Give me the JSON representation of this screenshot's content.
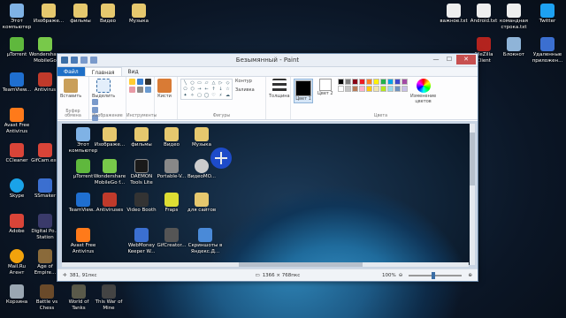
{
  "desktop": {
    "left_icons": [
      {
        "label": "Этот компьютер",
        "color": "#7fb2e5"
      },
      {
        "label": "Изображе...",
        "color": "#e6c86e"
      },
      {
        "label": "фильмы",
        "color": "#e6c86e"
      },
      {
        "label": "Видео",
        "color": "#e6c86e"
      },
      {
        "label": "Музыка",
        "color": "#e6c86e"
      },
      {
        "label": "µTorrent",
        "color": "#5fb83d"
      },
      {
        "label": "Wondershare MobileGo",
        "color": "#78c94a"
      },
      {
        "label": "TeamView...",
        "color": "#1f6fd0"
      },
      {
        "label": "Antivirus",
        "color": "#c03a2b"
      },
      {
        "label": "Avast Free Antivirus",
        "color": "#ff7a1a"
      },
      {
        "label": "CCleaner",
        "color": "#d94438"
      },
      {
        "label": "GifCam.exe",
        "color": "#d94438"
      },
      {
        "label": "Skype",
        "color": "#1aa3e8"
      },
      {
        "label": "SSmaker",
        "color": "#3b6fd0"
      },
      {
        "label": "Adobe",
        "color": "#d94438"
      },
      {
        "label": "Digital Po... Station",
        "color": "#3a3a6a"
      },
      {
        "label": "Mail.Ru Агент",
        "color": "#f2a20c"
      },
      {
        "label": "Age of Empire...",
        "color": "#8a6a3a"
      },
      {
        "label": "Корзина",
        "color": "#9aa6b2"
      },
      {
        "label": "Battle vs Chess",
        "color": "#6a4a2a"
      },
      {
        "label": "World of Tanks",
        "color": "#5a5a4a"
      },
      {
        "label": "This War of Mine",
        "color": "#444444"
      }
    ],
    "right_icons": [
      {
        "label": "важное.txt",
        "color": "#eeeeee"
      },
      {
        "label": "Android.txt",
        "color": "#eeeeee"
      },
      {
        "label": "командная строка.txt",
        "color": "#eeeeee"
      },
      {
        "label": "Twitter",
        "color": "#1da1f2"
      },
      {
        "label": "FileZilla Client",
        "color": "#b3231e"
      },
      {
        "label": "Блокнот",
        "color": "#8fb4d8"
      },
      {
        "label": "Удаленные приложен...",
        "color": "#3b6fd0"
      }
    ]
  },
  "paint": {
    "title": "Безымянный - Paint",
    "tabs": {
      "file": "Файл",
      "home": "Главная",
      "view": "Вид"
    },
    "ribbon": {
      "paste": "Вставить",
      "select": "Выделить",
      "brushes": "Кисти",
      "outline": "Контур",
      "fill": "Заливка",
      "thickness": "Толщина",
      "color1": "Цвет 1",
      "color2": "Цвет 2",
      "edit_colors": "Изменение цветов",
      "groups": {
        "clipboard": "Буфер обмена",
        "image": "Изображение",
        "tools": "Инструменты",
        "shapes": "Фигуры",
        "colors": "Цвета"
      },
      "shape_glyphs": [
        "╲",
        "○",
        "▭",
        "▱",
        "△",
        "▷",
        "◇",
        "⬠",
        "⬡",
        "→",
        "←",
        "↑",
        "↓",
        "☆",
        "✦",
        "✧",
        "▢",
        "◯",
        "♡",
        "⚡",
        "☁"
      ],
      "palette": [
        "#000000",
        "#7f7f7f",
        "#880015",
        "#ed1c24",
        "#ff7f27",
        "#fff200",
        "#22b14c",
        "#00a2e8",
        "#3f48cc",
        "#a349a4",
        "#ffffff",
        "#c3c3c3",
        "#b97a57",
        "#ffaec9",
        "#ffc90e",
        "#efe4b0",
        "#b5e61d",
        "#99d9ea",
        "#7092be",
        "#c8bfe7"
      ]
    },
    "canvas_icons": [
      {
        "label": "Этот компьютер",
        "color": "#7fb2e5"
      },
      {
        "label": "Изображе...",
        "color": "#e6c86e"
      },
      {
        "label": "фильмы",
        "color": "#e6c86e"
      },
      {
        "label": "Видео",
        "color": "#e6c86e"
      },
      {
        "label": "Музыка",
        "color": "#e6c86e"
      },
      {
        "label": "µTorrent",
        "color": "#5fb83d"
      },
      {
        "label": "Wondershare MobileGo f...",
        "color": "#78c94a"
      },
      {
        "label": "DAEMON Tools Lite",
        "color": "#1a1a1a"
      },
      {
        "label": "Portable-V...",
        "color": "#888888"
      },
      {
        "label": "ВидеоMO...",
        "color": "#cccccc"
      },
      {
        "label": "TeamView...",
        "color": "#1f6fd0"
      },
      {
        "label": "Antiviruses",
        "color": "#c03a2b"
      },
      {
        "label": "Video Booth",
        "color": "#333333"
      },
      {
        "label": "Fraps",
        "color": "#dddd33"
      },
      {
        "label": "для сайтов",
        "color": "#e6c86e"
      },
      {
        "label": "Avast Free Antivirus",
        "color": "#ff7a1a"
      },
      {
        "label": "WebMoney Keeper W...",
        "color": "#3b6fd0"
      },
      {
        "label": "GifCreator...",
        "color": "#555555"
      },
      {
        "label": "Скриншоты в Яндекс.Д...",
        "color": "#4a8ad8"
      }
    ],
    "status": {
      "cursor_pos": "381, 91пкс",
      "image_size": "1366 × 768пкс",
      "zoom": "100%"
    }
  }
}
